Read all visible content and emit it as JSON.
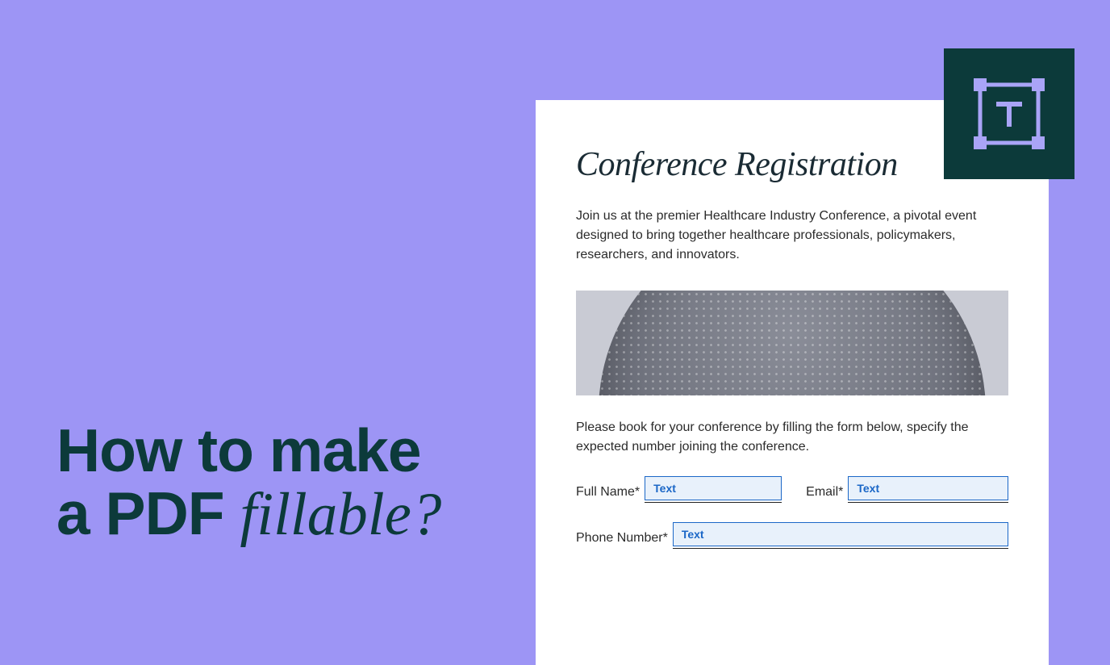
{
  "headline": {
    "line1": "How to make",
    "line2_prefix": "a PDF ",
    "line2_scripty": "fillable?"
  },
  "doc": {
    "title": "Conference Registration",
    "description": "Join us at the premier Healthcare Industry Conference, a pivotal event designed to bring together healthcare professionals, policymakers, researchers, and innovators.",
    "instruction": "Please book for your conference by filling the form below, specify the expected number joining the conference.",
    "fields": {
      "full_name": {
        "label": "Full Name*",
        "placeholder": "Text"
      },
      "email": {
        "label": "Email*",
        "placeholder": "Text"
      },
      "phone": {
        "label": "Phone Number*",
        "placeholder": "Text"
      }
    }
  },
  "tool": {
    "icon_name": "text-frame-icon"
  },
  "colors": {
    "background": "#9d95f5",
    "headline": "#0c3a3a",
    "badge_bg": "#0c3a3a",
    "badge_icon": "#a9a4f7",
    "field_border": "#1b67c7",
    "field_bg": "#e8f1fb"
  }
}
